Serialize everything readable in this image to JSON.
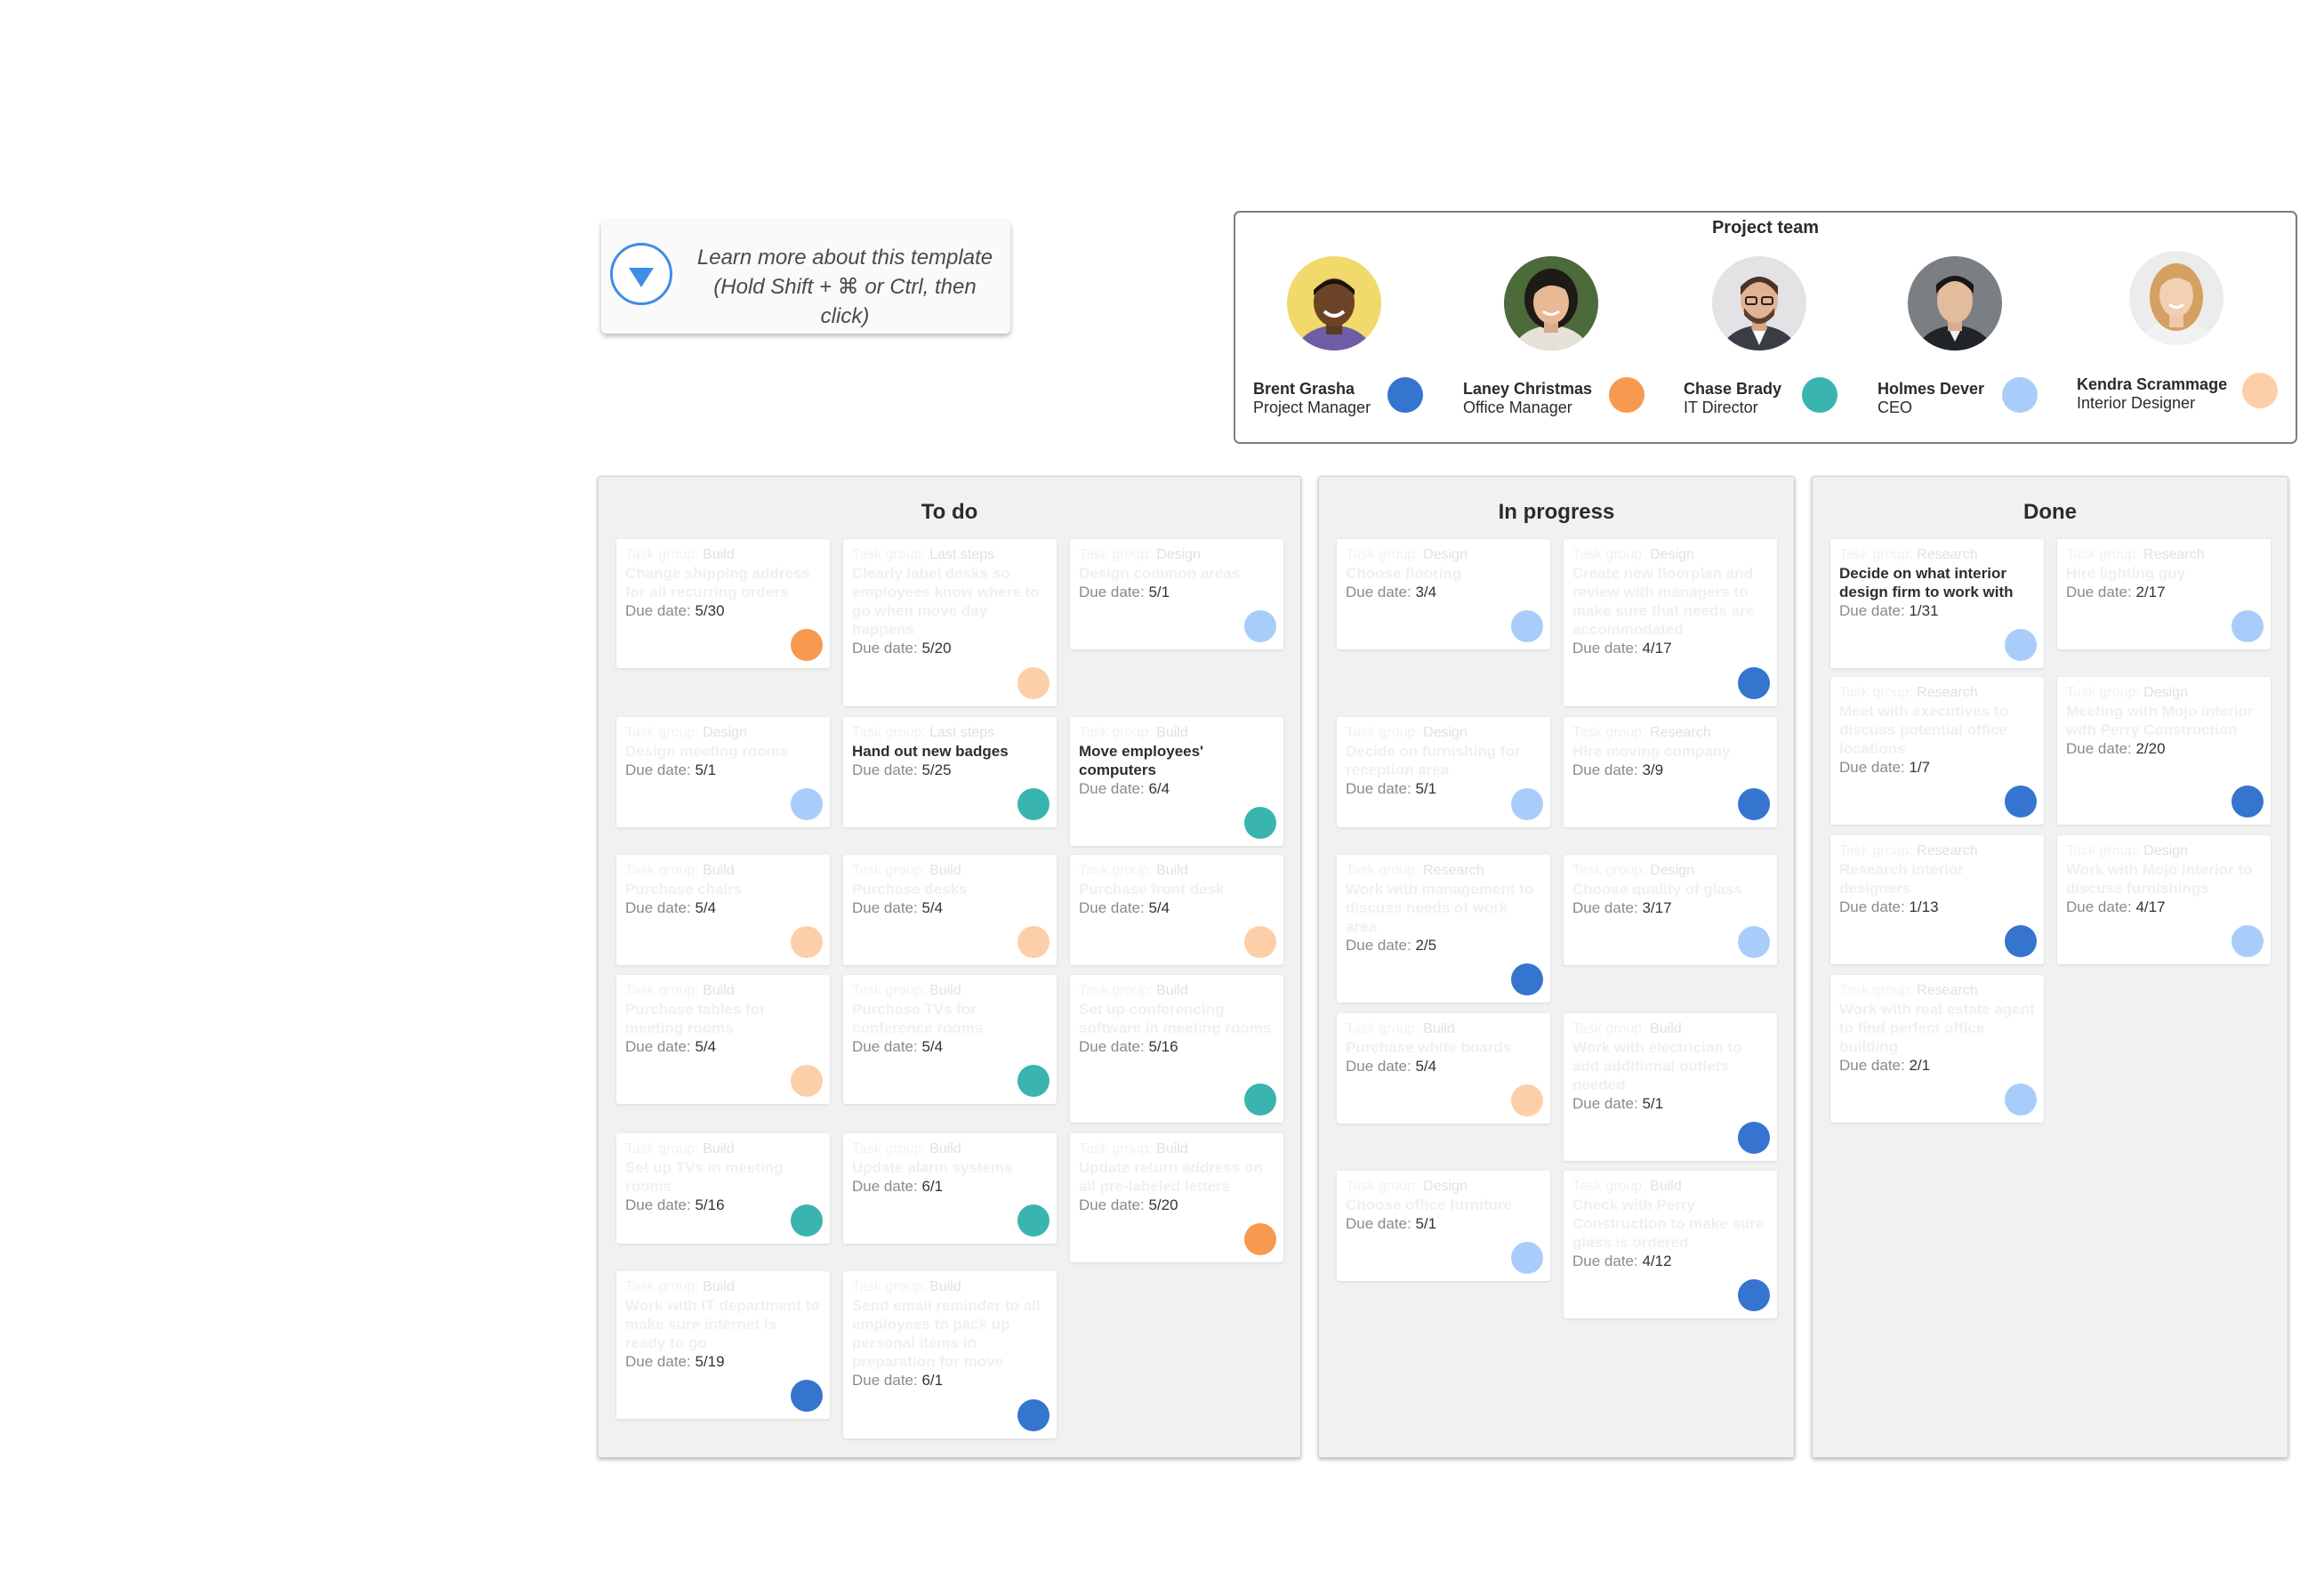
{
  "learn_more": {
    "line1": "Learn more about this template",
    "line2": "(Hold Shift + ⌘ or Ctrl, then click)",
    "icon": "triangle-down-icon"
  },
  "team": {
    "title": "Project team",
    "members": [
      {
        "name": "Brent Grasha",
        "role": "Project Manager",
        "color": "#3574cf"
      },
      {
        "name": "Laney Christmas",
        "role": "Office Manager",
        "color": "#f7994f"
      },
      {
        "name": "Chase Brady",
        "role": "IT Director",
        "color": "#3ab4ae"
      },
      {
        "name": "Holmes Dever",
        "role": "CEO",
        "color": "#a9cdfa"
      },
      {
        "name": "Kendra Scrammage",
        "role": "Interior Designer",
        "color": "#fdcfa8"
      }
    ]
  },
  "labels": {
    "task_group": "Task group:",
    "due_date": "Due date:"
  },
  "columns": [
    {
      "title": "To do",
      "cards": [
        {
          "group": "Build",
          "title": "Change shipping address for all recurring orders",
          "due": "5/30",
          "owner": 1,
          "hl": false
        },
        {
          "group": "Last steps",
          "title": "Clearly label desks so employees know where to go when move day happens",
          "due": "5/20",
          "owner": 4,
          "hl": false
        },
        {
          "group": "Design",
          "title": "Design common areas",
          "due": "5/1",
          "owner": 3,
          "hl": false
        },
        {
          "group": "Design",
          "title": "Design meeting rooms",
          "due": "5/1",
          "owner": 3,
          "hl": false
        },
        {
          "group": "Last steps",
          "title": "Hand out new badges",
          "due": "5/25",
          "owner": 2,
          "hl": true
        },
        {
          "group": "Build",
          "title": "Move employees' computers",
          "due": "6/4",
          "owner": 2,
          "hl": true
        },
        {
          "group": "Build",
          "title": "Purchase chairs",
          "due": "5/4",
          "owner": 4,
          "hl": false
        },
        {
          "group": "Build",
          "title": "Purchase desks",
          "due": "5/4",
          "owner": 4,
          "hl": false
        },
        {
          "group": "Build",
          "title": "Purchase front desk",
          "due": "5/4",
          "owner": 4,
          "hl": false
        },
        {
          "group": "Build",
          "title": "Purchase tables for meeting rooms",
          "due": "5/4",
          "owner": 4,
          "hl": false
        },
        {
          "group": "Build",
          "title": "Purchase TVs for conference rooms",
          "due": "5/4",
          "owner": 2,
          "hl": false
        },
        {
          "group": "Build",
          "title": "Set up conferencing software in meeting rooms",
          "due": "5/16",
          "owner": 2,
          "hl": false
        },
        {
          "group": "Build",
          "title": "Set up TVs in meeting rooms",
          "due": "5/16",
          "owner": 2,
          "hl": false
        },
        {
          "group": "Build",
          "title": "Update alarm systems",
          "due": "6/1",
          "owner": 2,
          "hl": false
        },
        {
          "group": "Build",
          "title": "Update return address on all pre-labeled letters",
          "due": "5/20",
          "owner": 1,
          "hl": false
        },
        {
          "group": "Build",
          "title": "Work with IT department to make sure internet is ready to go",
          "due": "5/19",
          "owner": 0,
          "hl": false
        },
        {
          "group": "Build",
          "title": "Send email reminder to all employees to pack up personal items in preparation for move",
          "due": "6/1",
          "owner": 0,
          "hl": false
        }
      ]
    },
    {
      "title": "In progress",
      "cards": [
        {
          "group": "Design",
          "title": "Choose flooring",
          "due": "3/4",
          "owner": 3,
          "hl": false
        },
        {
          "group": "Design",
          "title": "Create new floorplan and review with managers to make sure that needs are accommodated",
          "due": "4/17",
          "owner": 0,
          "hl": false
        },
        {
          "group": "Design",
          "title": "Decide on furnishing for reception area",
          "due": "5/1",
          "owner": 3,
          "hl": false
        },
        {
          "group": "Research",
          "title": "Hire moving company",
          "due": "3/9",
          "owner": 0,
          "hl": false
        },
        {
          "group": "Research",
          "title": "Work with management to discuss needs of work area",
          "due": "2/5",
          "owner": 0,
          "hl": false
        },
        {
          "group": "Design",
          "title": "Choose quality of glass",
          "due": "3/17",
          "owner": 3,
          "hl": false
        },
        {
          "group": "Build",
          "title": "Purchase white boards",
          "due": "5/4",
          "owner": 4,
          "hl": false
        },
        {
          "group": "Build",
          "title": "Work with electrician to add additional outlets needed",
          "due": "5/1",
          "owner": 0,
          "hl": false
        },
        {
          "group": "Design",
          "title": "Choose office furniture",
          "due": "5/1",
          "owner": 3,
          "hl": false
        },
        {
          "group": "Build",
          "title": "Check with Perry Construction to make sure glass is ordered",
          "due": "4/12",
          "owner": 0,
          "hl": false
        }
      ]
    },
    {
      "title": "Done",
      "cards": [
        {
          "group": "Research",
          "title": "Decide on what interior design firm to work with",
          "due": "1/31",
          "owner": 3,
          "hl": true
        },
        {
          "group": "Research",
          "title": "Hire lighting guy",
          "due": "2/17",
          "owner": 3,
          "hl": false
        },
        {
          "group": "Research",
          "title": "Meet with executives to discuss potential office locations",
          "due": "1/7",
          "owner": 0,
          "hl": false
        },
        {
          "group": "Design",
          "title": "Meeting with Mojo Interior with Perry Construction",
          "due": "2/20",
          "owner": 0,
          "hl": false
        },
        {
          "group": "Research",
          "title": "Research interior designers",
          "due": "1/13",
          "owner": 0,
          "hl": false
        },
        {
          "group": "Design",
          "title": "Work with Mojo Interior to discuss furnishings",
          "due": "4/17",
          "owner": 3,
          "hl": false
        },
        {
          "group": "Research",
          "title": "Work with real estate agent to find perfect office building",
          "due": "2/1",
          "owner": 3,
          "hl": false
        }
      ]
    }
  ]
}
